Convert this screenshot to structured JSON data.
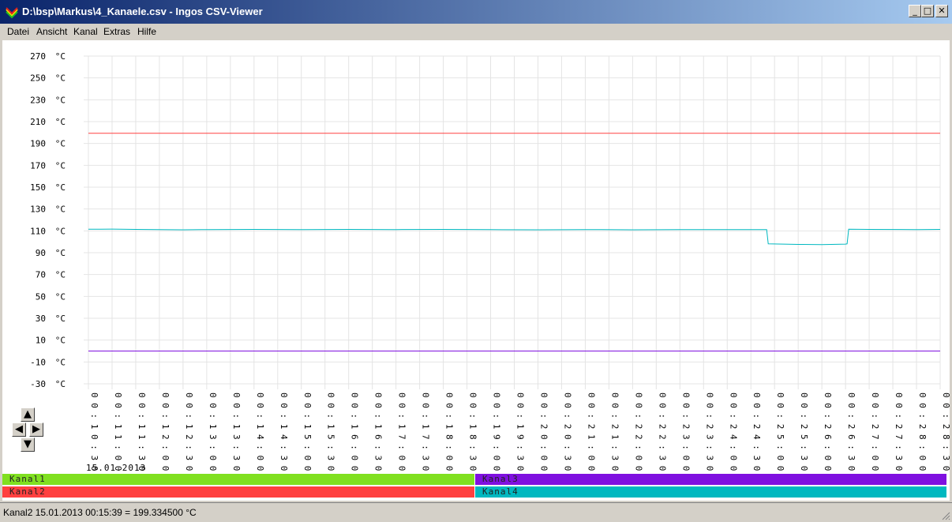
{
  "window": {
    "title": "D:\\bsp\\Markus\\4_Kanaele.csv - Ingos CSV-Viewer",
    "minimize": "_",
    "maximize": "□",
    "close": "✕"
  },
  "menu": [
    {
      "label": "Datei"
    },
    {
      "label": "Ansicht"
    },
    {
      "label": "Kanal"
    },
    {
      "label": "Extras"
    },
    {
      "label": "Hilfe"
    }
  ],
  "chart_data": {
    "type": "line",
    "yunit": "°C",
    "ylim": [
      -30,
      270
    ],
    "yticks": [
      270,
      250,
      230,
      210,
      190,
      170,
      150,
      130,
      110,
      90,
      70,
      50,
      30,
      10,
      -10,
      -30
    ],
    "ytick_labels": [
      "270 °C",
      "250 °C",
      "230 °C",
      "210 °C",
      "190 °C",
      "170 °C",
      "150 °C",
      "130 °C",
      "110 °C",
      "90 °C",
      "70 °C",
      "50 °C",
      "30 °C",
      "10 °C",
      "-10 °C",
      "-30 °C"
    ],
    "xlim": [
      "00:10:30",
      "00:28:30"
    ],
    "xticks": [
      "00:10:30",
      "00:11:00",
      "00:11:30",
      "00:12:00",
      "00:12:30",
      "00:13:00",
      "00:13:30",
      "00:14:00",
      "00:14:30",
      "00:15:00",
      "00:15:30",
      "00:16:00",
      "00:16:30",
      "00:17:00",
      "00:17:30",
      "00:18:00",
      "00:18:30",
      "00:19:00",
      "00:19:30",
      "00:20:00",
      "00:20:30",
      "00:21:00",
      "00:21:30",
      "00:22:00",
      "00:22:30",
      "00:23:00",
      "00:23:30",
      "00:24:00",
      "00:24:30",
      "00:25:00",
      "00:25:30",
      "00:26:00",
      "00:26:30",
      "00:27:00",
      "00:27:30",
      "00:28:00",
      "00:28:30"
    ],
    "grid": true,
    "date": "15.01.2013",
    "series": [
      {
        "name": "Kanal1",
        "color": "#80e020",
        "points": []
      },
      {
        "name": "Kanal2",
        "color": "#ff4040",
        "points": [
          [
            "00:10:30",
            199.3
          ],
          [
            "00:28:30",
            199.3
          ]
        ]
      },
      {
        "name": "Kanal3",
        "color": "#7f10e0",
        "points": [
          [
            "00:10:30",
            0
          ],
          [
            "00:28:30",
            0
          ]
        ]
      },
      {
        "name": "Kanal4",
        "color": "#00b8c0",
        "points": [
          [
            "00:10:30",
            111.5
          ],
          [
            "00:11:00",
            111.6
          ],
          [
            "00:11:30",
            111.3
          ],
          [
            "00:12:00",
            111.1
          ],
          [
            "00:12:30",
            111.0
          ],
          [
            "00:13:00",
            111.2
          ],
          [
            "00:14:00",
            111.3
          ],
          [
            "00:15:00",
            111.2
          ],
          [
            "00:16:00",
            111.3
          ],
          [
            "00:17:00",
            111.2
          ],
          [
            "00:18:00",
            111.3
          ],
          [
            "00:19:00",
            111.1
          ],
          [
            "00:20:00",
            111.0
          ],
          [
            "00:21:00",
            111.2
          ],
          [
            "00:22:00",
            111.0
          ],
          [
            "00:23:00",
            111.2
          ],
          [
            "00:24:00",
            111.2
          ],
          [
            "00:24:50",
            111.2
          ],
          [
            "00:24:52",
            98.2
          ],
          [
            "00:25:30",
            97.6
          ],
          [
            "00:26:00",
            97.4
          ],
          [
            "00:26:30",
            97.9
          ],
          [
            "00:26:32",
            98.1
          ],
          [
            "00:26:34",
            111.5
          ],
          [
            "00:27:00",
            111.3
          ],
          [
            "00:28:00",
            111.2
          ],
          [
            "00:28:30",
            111.3
          ]
        ]
      }
    ]
  },
  "legend": [
    {
      "name": "Kanal1",
      "color": "#80e020"
    },
    {
      "name": "Kanal3",
      "color": "#7f10e0"
    },
    {
      "name": "Kanal2",
      "color": "#ff4040"
    },
    {
      "name": "Kanal4",
      "color": "#00b8c0"
    }
  ],
  "nav": {
    "up": "▲",
    "down": "▼",
    "left": "◀",
    "right": "▶"
  },
  "status": "Kanal2 15.01.2013 00:15:39 = 199.334500 °C"
}
